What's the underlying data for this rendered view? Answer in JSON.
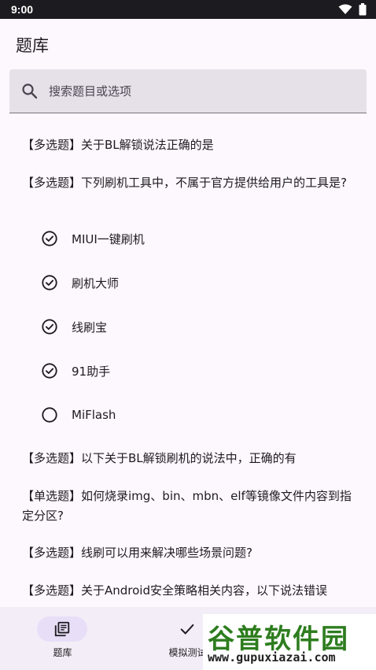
{
  "status_bar": {
    "time": "9:00"
  },
  "app_bar": {
    "title": "题库"
  },
  "search": {
    "placeholder": "搜索题目或选项",
    "value": ""
  },
  "questions": [
    {
      "text": "【多选题】关于BL解锁说法正确的是"
    },
    {
      "text": "【多选题】下列刷机工具中，不属于官方提供给用户的工具是?"
    },
    {
      "text": "【多选题】以下关于BL解锁刷机的说法中，正确的有"
    },
    {
      "text": "【单选题】如何烧录img、bin、mbn、elf等镜像文件内容到指定分区?"
    },
    {
      "text": "【多选题】线刷可以用来解决哪些场景问题?"
    },
    {
      "text": "【多选题】关于Android安全策略相关内容，以下说法错误"
    }
  ],
  "options": [
    {
      "label": "MIUI一键刷机",
      "checked": true
    },
    {
      "label": "刷机大师",
      "checked": true
    },
    {
      "label": "线刷宝",
      "checked": true
    },
    {
      "label": "91助手",
      "checked": true
    },
    {
      "label": "MiFlash",
      "checked": false
    }
  ],
  "bottom_nav": {
    "items": [
      {
        "label": "题库",
        "icon": "library-icon",
        "active": true
      },
      {
        "label": "模拟测试",
        "icon": "check-icon",
        "active": false
      }
    ]
  },
  "watermark": {
    "title": "谷普软件园",
    "url": "www.gupuxiazai.com"
  },
  "colors": {
    "background": "#fdf7fe",
    "status_bar": "#1c1b1f",
    "search_field": "#e6e0e9",
    "nav_bar": "#f3edf7",
    "nav_active_pill": "#e8def8",
    "watermark_green": "#2e7d1f"
  }
}
